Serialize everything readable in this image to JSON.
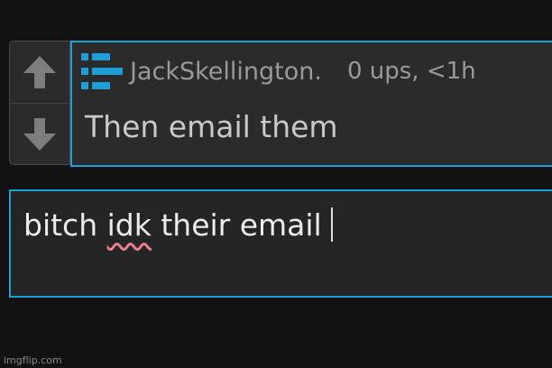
{
  "comment": {
    "username": "JackSkellington.",
    "meta": "0 ups, <1h",
    "text": "Then email them",
    "upvote_icon": "arrow-up-icon",
    "downvote_icon": "arrow-down-icon",
    "avatar_color": "#1ba0d8"
  },
  "reply": {
    "before": "bitch ",
    "misspelled": "idk",
    "after": " their email"
  },
  "watermark": "imgflip.com",
  "colors": {
    "accent": "#1ba0d8",
    "background": "#121212",
    "card": "#2b2b2b",
    "spellcheck": "#e97f8f"
  }
}
